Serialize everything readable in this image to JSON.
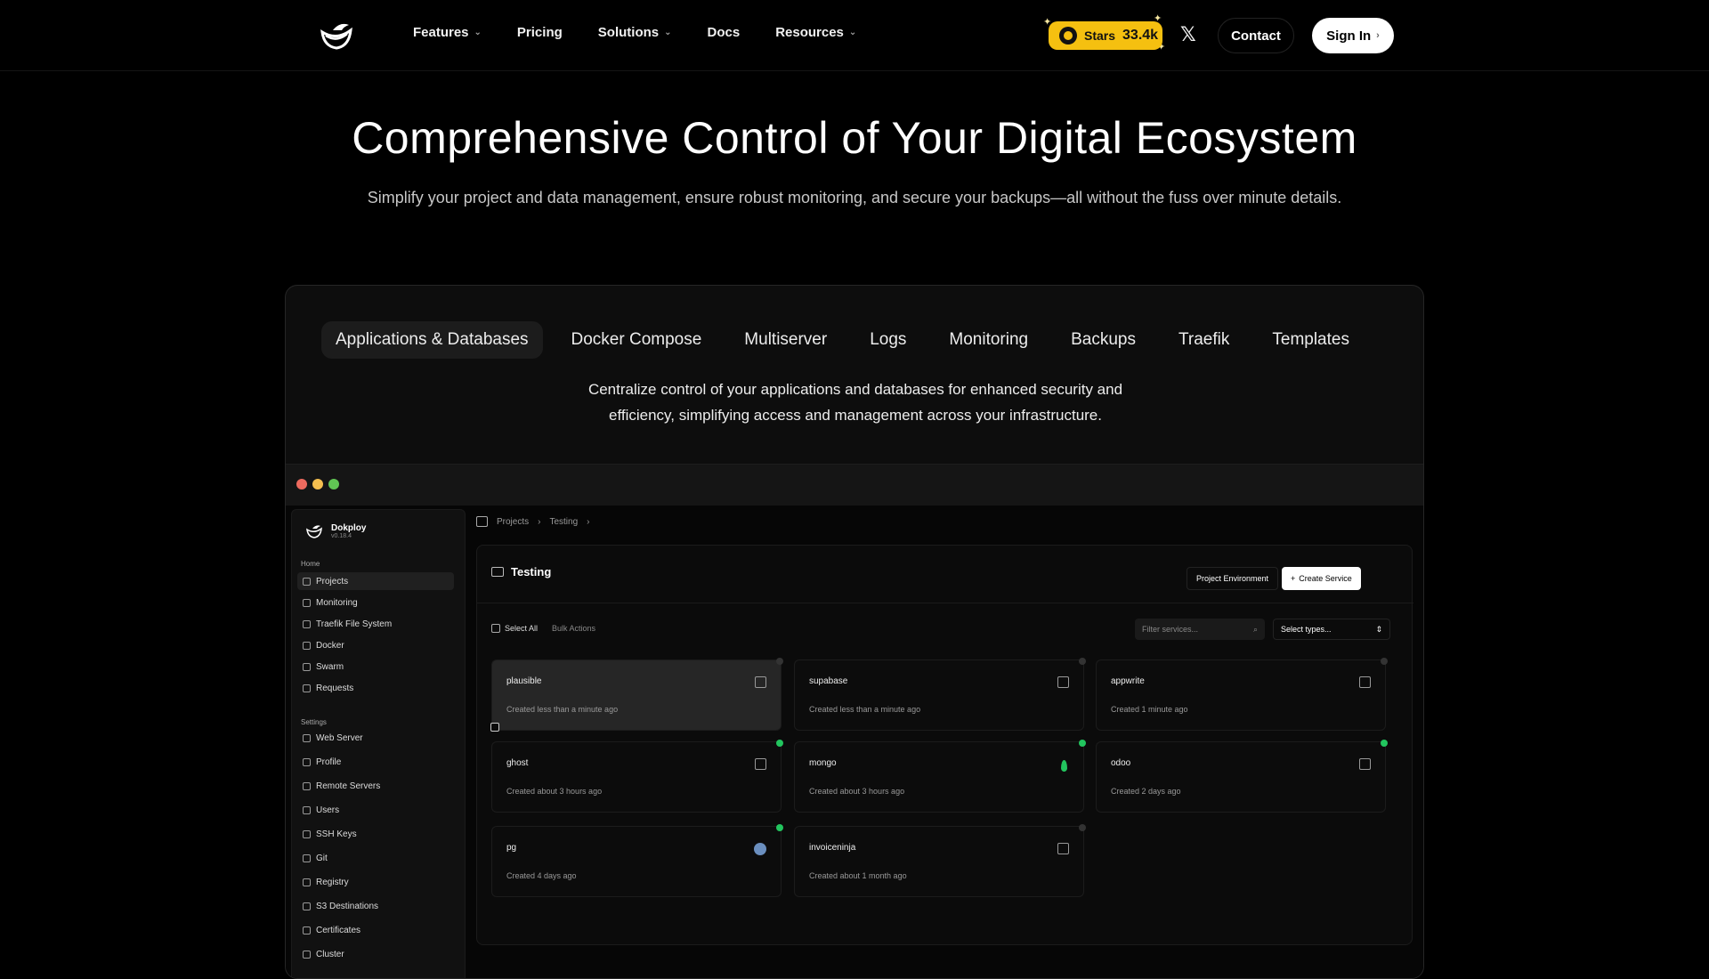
{
  "nav": {
    "logo": "dokploy-logo",
    "links": [
      {
        "label": "Features",
        "dropdown": true
      },
      {
        "label": "Pricing",
        "dropdown": false
      },
      {
        "label": "Solutions",
        "dropdown": true
      },
      {
        "label": "Docs",
        "dropdown": false
      },
      {
        "label": "Resources",
        "dropdown": true
      }
    ],
    "stars_label": "Stars",
    "stars_count": "33.4k",
    "contact": "Contact",
    "signin": "Sign In"
  },
  "hero": {
    "title": "Comprehensive Control of Your Digital Ecosystem",
    "subtitle": "Simplify your project and data management, ensure robust monitoring, and secure your backups—all without the fuss over minute details."
  },
  "tabs": [
    "Applications & Databases",
    "Docker Compose",
    "Multiserver",
    "Logs",
    "Monitoring",
    "Backups",
    "Traefik",
    "Templates"
  ],
  "active_tab": "Applications & Databases",
  "tab_description_line1": "Centralize control of your applications and databases for enhanced security and",
  "tab_description_line2": "efficiency, simplifying access and management across your infrastructure.",
  "window_dots": [
    "#ed6a5e",
    "#f5bf4f",
    "#61c554"
  ],
  "app": {
    "brand": "Dokploy",
    "version": "v0.18.4",
    "home_heading": "Home",
    "home_items": [
      "Projects",
      "Monitoring",
      "Traefik File System",
      "Docker",
      "Swarm",
      "Requests"
    ],
    "settings_heading": "Settings",
    "settings_items": [
      "Web Server",
      "Profile",
      "Remote Servers",
      "Users",
      "SSH Keys",
      "Git",
      "Registry",
      "S3 Destinations",
      "Certificates",
      "Cluster"
    ],
    "breadcrumb": [
      "Projects",
      "Testing"
    ],
    "project_title": "Testing",
    "project_env_button": "Project Environment",
    "create_service_button": "Create Service",
    "select_all": "Select All",
    "bulk_actions": "Bulk Actions",
    "filter_placeholder": "Filter services...",
    "select_types": "Select types...",
    "services": [
      {
        "name": "plausible",
        "created": "Created less than a minute ago",
        "icon": "app-icon",
        "status": "idle"
      },
      {
        "name": "supabase",
        "created": "Created less than a minute ago",
        "icon": "app-icon",
        "status": "idle"
      },
      {
        "name": "appwrite",
        "created": "Created 1 minute ago",
        "icon": "app-icon",
        "status": "idle"
      },
      {
        "name": "ghost",
        "created": "Created about 3 hours ago",
        "icon": "app-icon",
        "status": "running"
      },
      {
        "name": "mongo",
        "created": "Created about 3 hours ago",
        "icon": "mongo-leaf-icon",
        "status": "running"
      },
      {
        "name": "odoo",
        "created": "Created 2 days ago",
        "icon": "app-icon",
        "status": "running"
      },
      {
        "name": "pg",
        "created": "Created 4 days ago",
        "icon": "postgres-icon",
        "status": "running"
      },
      {
        "name": "invoiceninja",
        "created": "Created about 1 month ago",
        "icon": "app-icon",
        "status": "idle"
      }
    ]
  }
}
